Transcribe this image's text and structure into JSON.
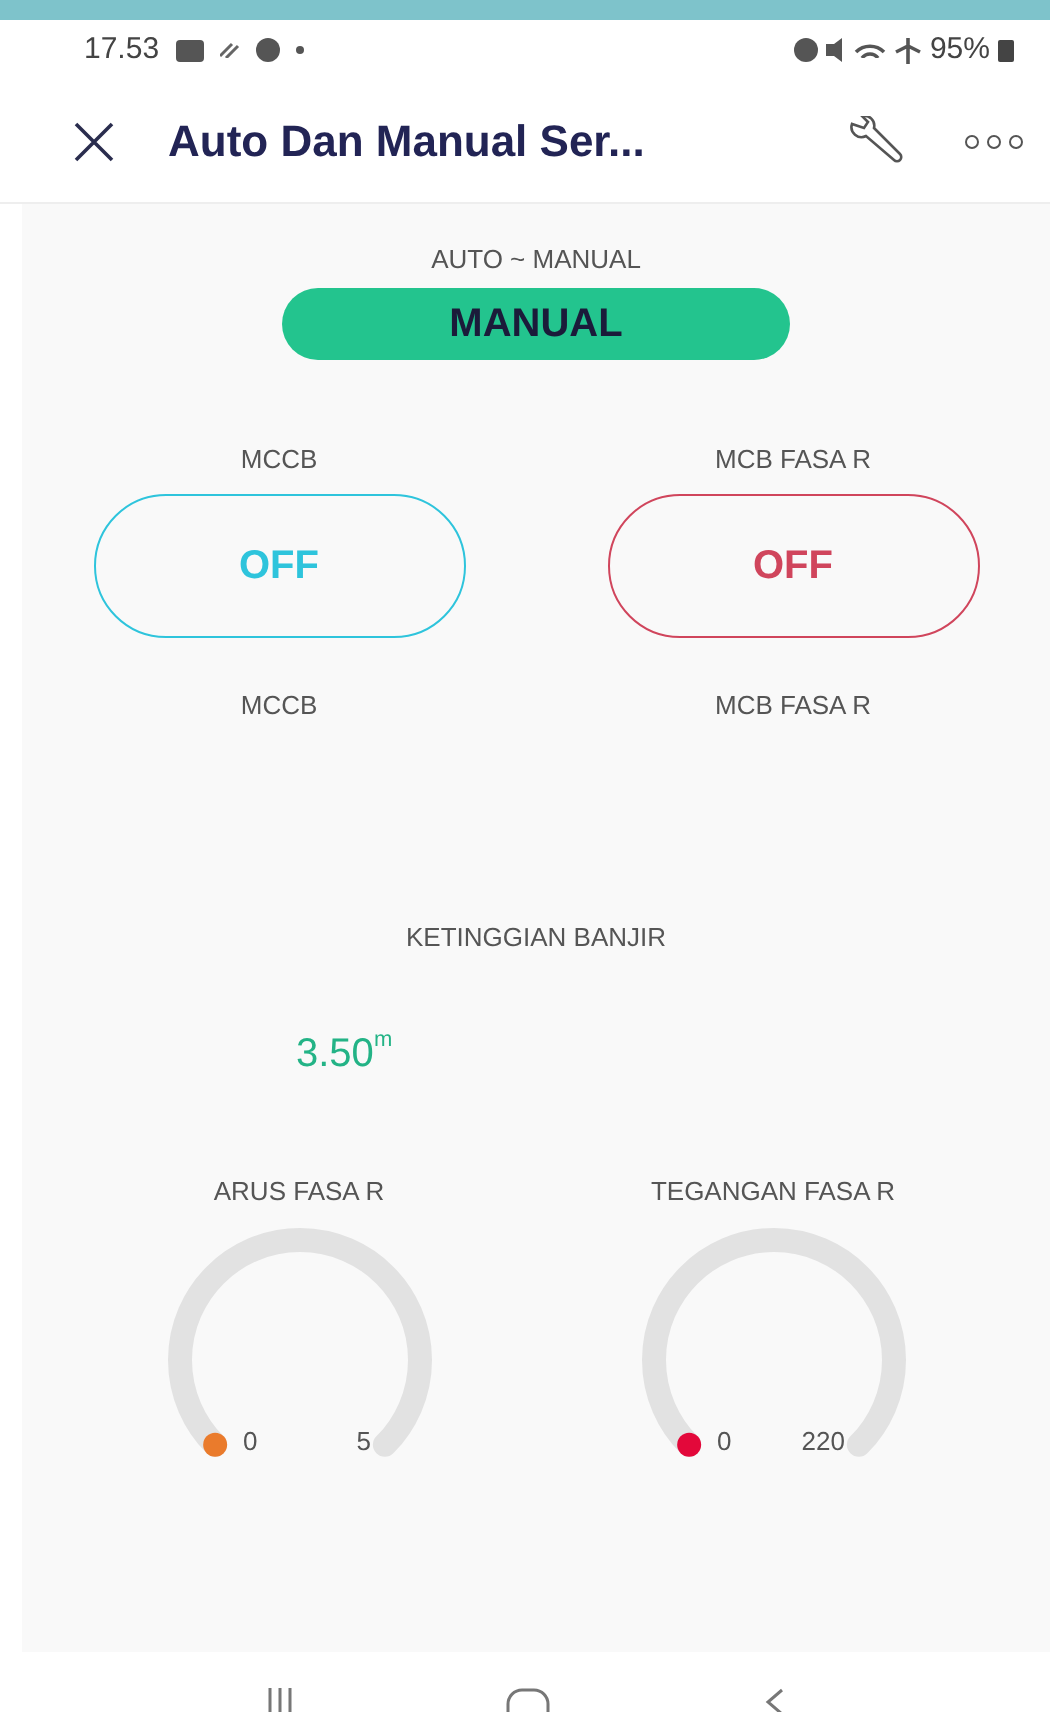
{
  "status_bar": {
    "time": "17.53",
    "battery": "95%"
  },
  "header": {
    "title": "Auto Dan Manual Ser..."
  },
  "mode": {
    "label": "AUTO ~ MANUAL",
    "value": "MANUAL",
    "on": true
  },
  "switches": [
    {
      "label": "MCCB",
      "state": "OFF",
      "on": false,
      "color": "#2ec4dc",
      "caption": "MCCB"
    },
    {
      "label": "MCB FASA R",
      "state": "OFF",
      "on": false,
      "color": "#d0455c",
      "caption": "MCB FASA R"
    }
  ],
  "level_display": {
    "label": "KETINGGIAN BANJIR",
    "value": "3.50",
    "unit": "m"
  },
  "gauges": [
    {
      "label": "ARUS FASA R",
      "min": "0",
      "max": "5",
      "color": "#ea7b2c"
    },
    {
      "label": "TEGANGAN FASA R",
      "min": "0",
      "max": "220",
      "color": "#e3083a"
    }
  ]
}
